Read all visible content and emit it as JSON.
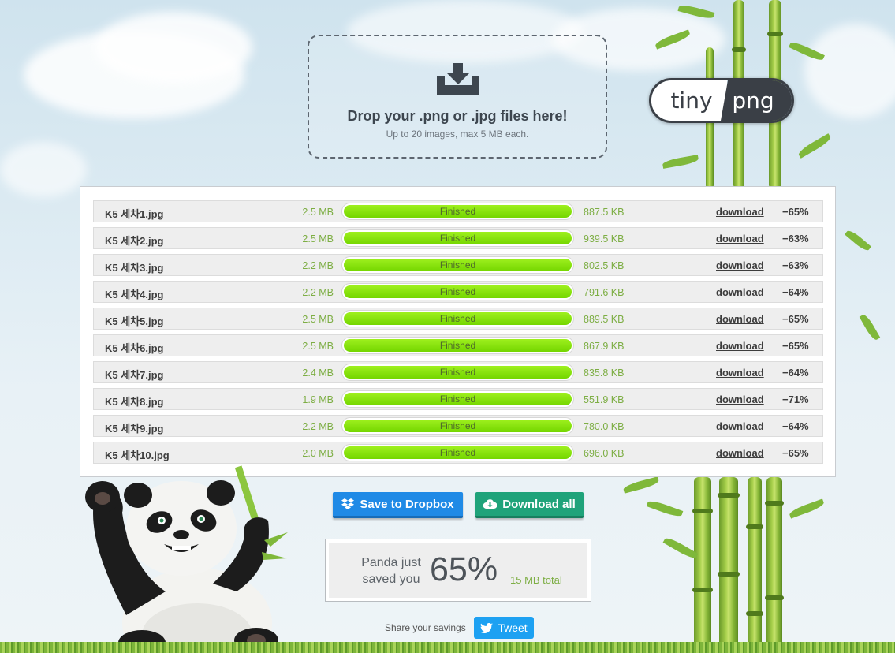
{
  "dropzone": {
    "title": "Drop your .png or .jpg files here!",
    "subtitle": "Up to 20 images, max 5 MB each."
  },
  "logo": {
    "left": "tiny",
    "right": "png"
  },
  "files": [
    {
      "name": "K5 세차1.jpg",
      "original": "2.5 MB",
      "status": "Finished",
      "progress": 100,
      "compressed": "887.5 KB",
      "action": "download",
      "saving": "−65%"
    },
    {
      "name": "K5 세차2.jpg",
      "original": "2.5 MB",
      "status": "Finished",
      "progress": 100,
      "compressed": "939.5 KB",
      "action": "download",
      "saving": "−63%"
    },
    {
      "name": "K5 세차3.jpg",
      "original": "2.2 MB",
      "status": "Finished",
      "progress": 100,
      "compressed": "802.5 KB",
      "action": "download",
      "saving": "−63%"
    },
    {
      "name": "K5 세차4.jpg",
      "original": "2.2 MB",
      "status": "Finished",
      "progress": 100,
      "compressed": "791.6 KB",
      "action": "download",
      "saving": "−64%"
    },
    {
      "name": "K5 세차5.jpg",
      "original": "2.5 MB",
      "status": "Finished",
      "progress": 100,
      "compressed": "889.5 KB",
      "action": "download",
      "saving": "−65%"
    },
    {
      "name": "K5 세차6.jpg",
      "original": "2.5 MB",
      "status": "Finished",
      "progress": 100,
      "compressed": "867.9 KB",
      "action": "download",
      "saving": "−65%"
    },
    {
      "name": "K5 세차7.jpg",
      "original": "2.4 MB",
      "status": "Finished",
      "progress": 100,
      "compressed": "835.8 KB",
      "action": "download",
      "saving": "−64%"
    },
    {
      "name": "K5 세차8.jpg",
      "original": "1.9 MB",
      "status": "Finished",
      "progress": 100,
      "compressed": "551.9 KB",
      "action": "download",
      "saving": "−71%"
    },
    {
      "name": "K5 세차9.jpg",
      "original": "2.2 MB",
      "status": "Finished",
      "progress": 100,
      "compressed": "780.0 KB",
      "action": "download",
      "saving": "−64%"
    },
    {
      "name": "K5 세차10.jpg",
      "original": "2.0 MB",
      "status": "Finished",
      "progress": 100,
      "compressed": "696.0 KB",
      "action": "download",
      "saving": "−65%"
    }
  ],
  "actions": {
    "dropbox": "Save to Dropbox",
    "download_all": "Download all"
  },
  "savings": {
    "line1": "Panda just",
    "line2": "saved you",
    "percent": "65%",
    "total": "15 MB total"
  },
  "share": {
    "label": "Share your savings",
    "tweet": "Tweet"
  },
  "colors": {
    "progress": "#8ce614",
    "dropbox": "#1f8ae6",
    "download_all": "#1fa37a",
    "tweet": "#1da1f2",
    "size_text": "#7dae44"
  }
}
